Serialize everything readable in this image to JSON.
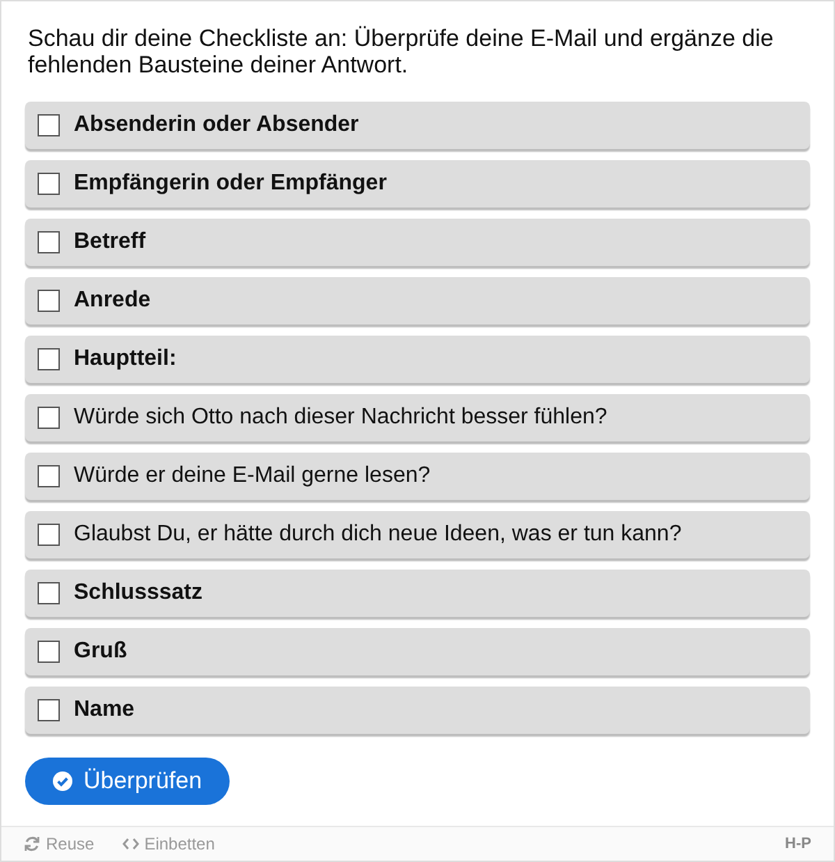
{
  "instruction": "Schau dir deine Checkliste an: Überprüfe deine E-Mail und ergänze die fehlenden Bausteine deiner Antwort.",
  "items": [
    {
      "label": "Absenderin oder Absender",
      "kind": "heading",
      "checked": false
    },
    {
      "label": "Empfängerin oder Empfänger",
      "kind": "heading",
      "checked": false
    },
    {
      "label": "Betreff",
      "kind": "heading",
      "checked": false
    },
    {
      "label": "Anrede",
      "kind": "heading",
      "checked": false
    },
    {
      "label": "Hauptteil:",
      "kind": "heading",
      "checked": false
    },
    {
      "label": "Würde sich Otto nach dieser Nachricht besser fühlen?",
      "kind": "question",
      "checked": false
    },
    {
      "label": "Würde er deine E-Mail gerne lesen?",
      "kind": "question",
      "checked": false
    },
    {
      "label": "Glaubst Du, er hätte durch dich neue Ideen, was er tun kann?",
      "kind": "question",
      "checked": false
    },
    {
      "label": "Schlusssatz",
      "kind": "heading",
      "checked": false
    },
    {
      "label": "Gruß",
      "kind": "heading",
      "checked": false
    },
    {
      "label": "Name",
      "kind": "heading",
      "checked": false
    }
  ],
  "check_button": "Überprüfen",
  "footer": {
    "reuse": "Reuse",
    "embed": "Einbetten",
    "logo": "H-P"
  }
}
